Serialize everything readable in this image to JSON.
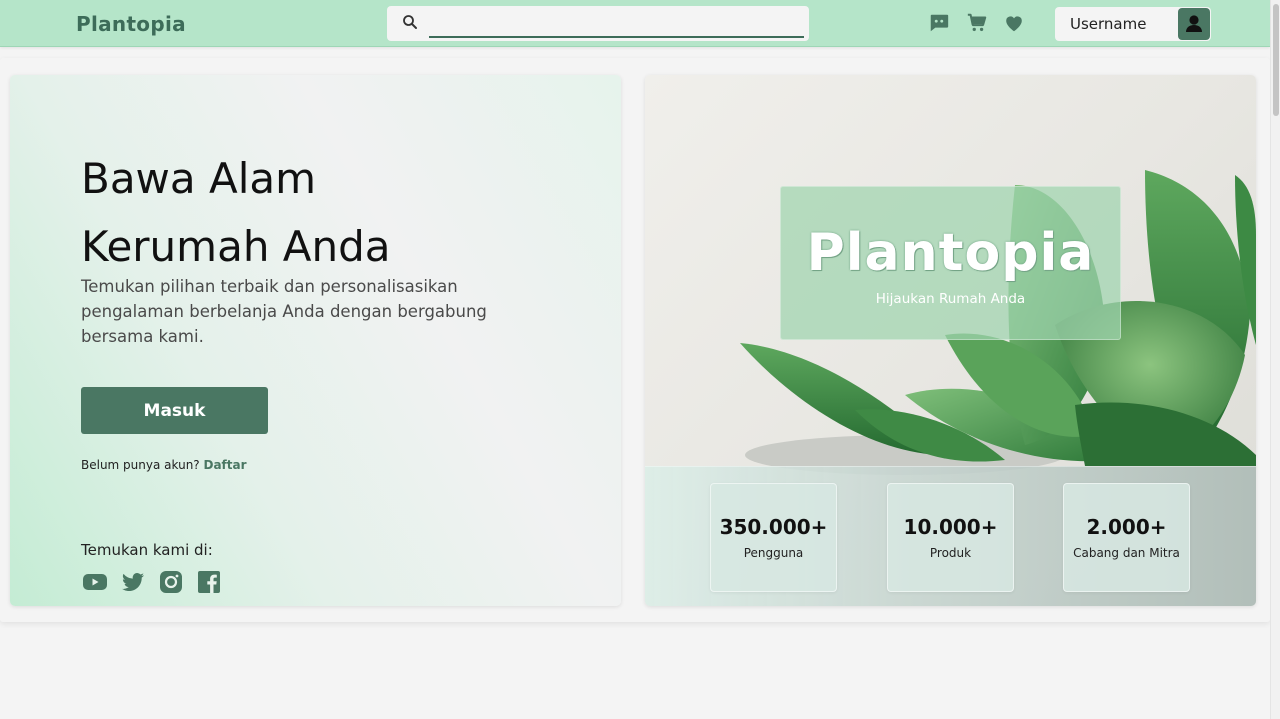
{
  "navbar": {
    "brand": "Plantopia",
    "search_placeholder": "",
    "icons": [
      "chat-icon",
      "cart-icon",
      "heart-icon"
    ],
    "username": "Username",
    "bg_color": "#b5e5c9",
    "accent_color": "#4a7763"
  },
  "hero": {
    "headline_line1": "Bawa Alam",
    "headline_line2": "Kerumah Anda",
    "subtext": "Temukan pilihan terbaik dan personalisasikan pengalaman berbelanja Anda dengan bergabung bersama kami.",
    "login_button": "Masuk",
    "register_prompt": "Belum punya akun?",
    "register_link": "Daftar",
    "find_us_label": "Temukan kami di:",
    "social_icons": [
      "youtube-icon",
      "twitter-icon",
      "instagram-icon",
      "facebook-icon"
    ]
  },
  "showcase": {
    "brand_title": "Plantopia",
    "tagline": "Hijaukan Rumah Anda",
    "stats": [
      {
        "value": "350.000+",
        "label": "Pengguna"
      },
      {
        "value": "10.000+",
        "label": "Produk"
      },
      {
        "value": "2.000+",
        "label": "Cabang dan Mitra"
      }
    ]
  }
}
